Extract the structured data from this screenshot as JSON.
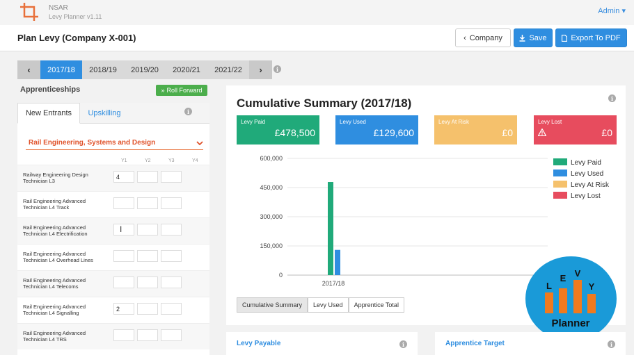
{
  "app": {
    "name": "NSAR",
    "version": "Levy Planner v1.11",
    "user": "Admin ▾"
  },
  "page": {
    "title": "Plan Levy (Company X-001)"
  },
  "toolbar": {
    "company": "Company",
    "save": "Save",
    "export": "Export To PDF"
  },
  "years": {
    "items": [
      "2017/18",
      "2018/19",
      "2019/20",
      "2020/21",
      "2021/22"
    ],
    "active": "2017/18"
  },
  "apprenticeships": {
    "label": "Apprenticeships",
    "roll_forward": "Roll Forward",
    "tabs": [
      "New Entrants",
      "Upskilling"
    ],
    "category": "Rail Engineering, Systems and Design",
    "columns": [
      "Y1",
      "Y2",
      "Y3",
      "Y4"
    ],
    "rows": [
      {
        "name": "Railway Engineering Design Technician L3",
        "y1": "4"
      },
      {
        "name": "Rail Engineering Advanced Technician L4 Track",
        "y1": ""
      },
      {
        "name": "Rail Engineering Advanced Technician L4 Electrification",
        "y1": ""
      },
      {
        "name": "Rail Engineering Advanced Technician L4 Overhead Lines",
        "y1": ""
      },
      {
        "name": "Rail Engineering Advanced Technician L4 Telecoms",
        "y1": ""
      },
      {
        "name": "Rail Engineering Advanced Technician L4 Signalling",
        "y1": "2"
      },
      {
        "name": "Rail Engineering Advanced Technician L4 TRS",
        "y1": ""
      }
    ]
  },
  "summary": {
    "title": "Cumulative Summary (2017/18)",
    "cards": [
      {
        "label": "Levy Paid",
        "value": "£478,500"
      },
      {
        "label": "Levy Used",
        "value": "£129,600"
      },
      {
        "label": "Levy At Risk",
        "value": "£0"
      },
      {
        "label": "Levy Lost",
        "value": "£0"
      }
    ],
    "tabs": [
      "Cumulative Summary",
      "Levy Used",
      "Apprentice Total"
    ]
  },
  "chart_data": {
    "type": "bar",
    "categories": [
      "2017/18"
    ],
    "series": [
      {
        "name": "Levy Paid",
        "values": [
          478500
        ],
        "color": "#20aa7a"
      },
      {
        "name": "Levy Used",
        "values": [
          129600
        ],
        "color": "#2f8ee0"
      },
      {
        "name": "Levy At Risk",
        "values": [
          0
        ],
        "color": "#f5c16c"
      },
      {
        "name": "Levy Lost",
        "values": [
          0
        ],
        "color": "#e74c5e"
      }
    ],
    "ylim": [
      0,
      600000
    ],
    "yticks": [
      "0",
      "150,000",
      "300,000",
      "450,000",
      "600,000"
    ],
    "grid": true,
    "legend": "right"
  },
  "badge": {
    "letters": [
      "L",
      "E",
      "V",
      "Y"
    ],
    "text": "Planner"
  },
  "panels": {
    "levy_payable": "Levy Payable",
    "apprentice_target": "Apprentice Target"
  },
  "icons": {
    "info": "info-icon"
  }
}
